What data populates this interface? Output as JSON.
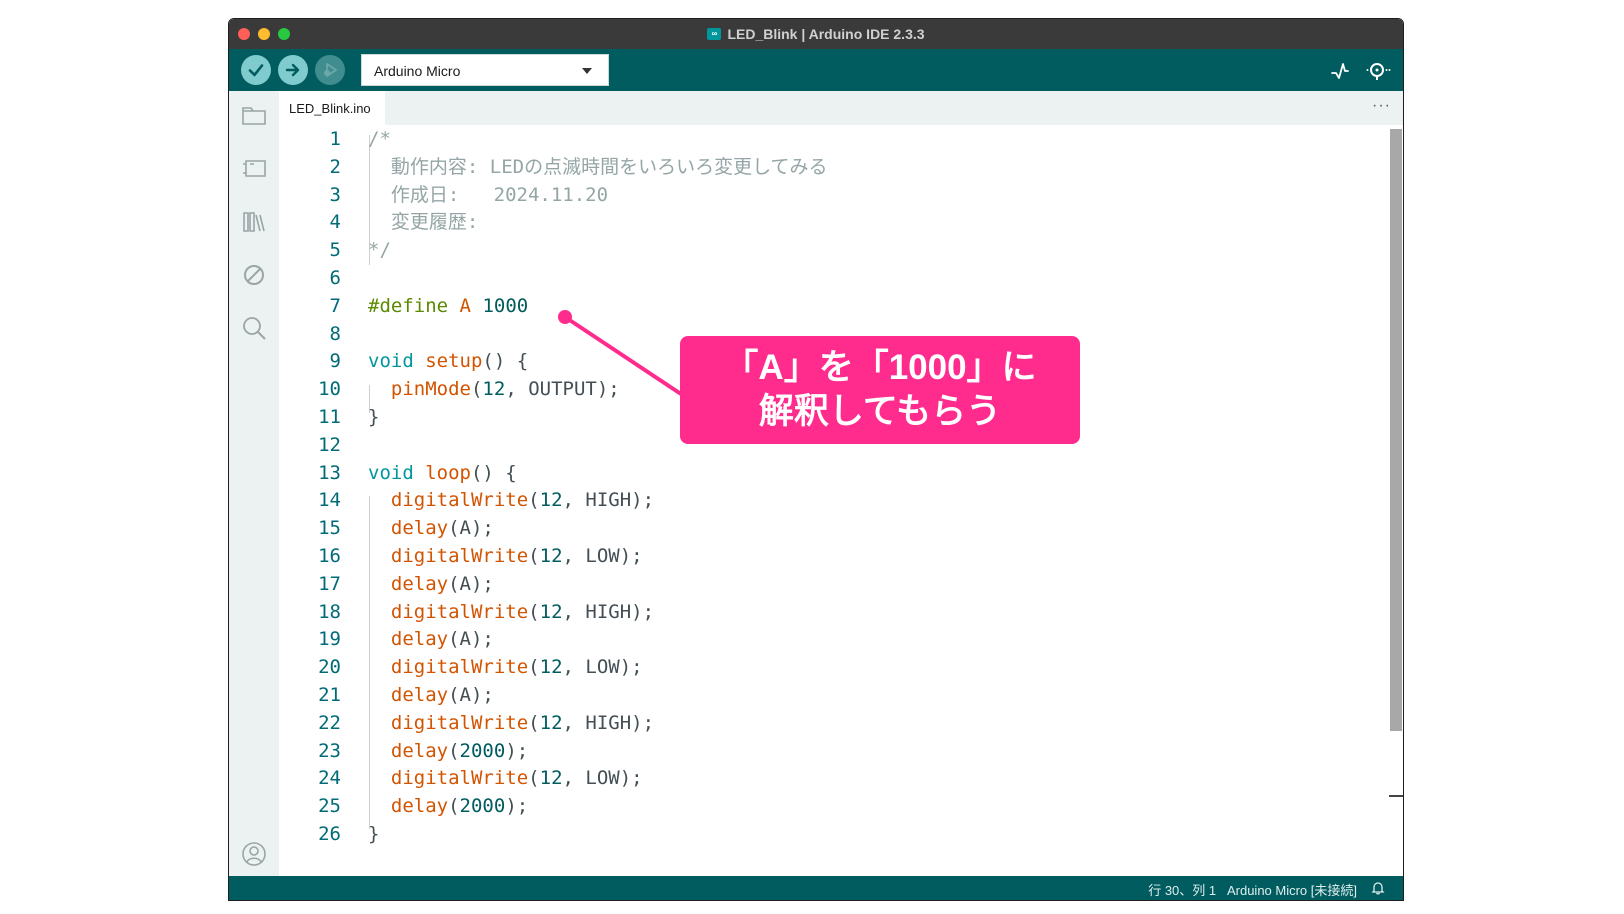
{
  "window": {
    "title": "LED_Blink | Arduino IDE 2.3.3",
    "title_icon": "arduino-logo-icon"
  },
  "toolbar": {
    "verify_icon": "check-icon",
    "upload_icon": "arrow-right-icon",
    "debug_icon": "debug-icon",
    "board_selected": "Arduino Micro",
    "serial_plotter_icon": "pulse-icon",
    "serial_monitor_icon": "magnifier-dots-icon"
  },
  "sidebar": {
    "items": [
      "folder-icon",
      "board-icon",
      "library-icon",
      "debug-off-icon",
      "search-icon"
    ],
    "bottom": "profile-icon"
  },
  "tabs": [
    {
      "label": "LED_Blink.ino",
      "active": true
    }
  ],
  "tab_more": "···",
  "editor": {
    "lines": [
      {
        "n": "1",
        "tokens": [
          [
            "c-com",
            "/*"
          ]
        ]
      },
      {
        "n": "2",
        "tokens": [
          [
            "c-com",
            "  動作内容: LEDの点滅時間をいろいろ変更してみる"
          ]
        ]
      },
      {
        "n": "3",
        "tokens": [
          [
            "c-com",
            "  作成日:   2024.11.20"
          ]
        ]
      },
      {
        "n": "4",
        "tokens": [
          [
            "c-com",
            "  変更履歴:"
          ]
        ]
      },
      {
        "n": "5",
        "tokens": [
          [
            "c-com",
            "*/"
          ]
        ]
      },
      {
        "n": "6",
        "tokens": []
      },
      {
        "n": "7",
        "tokens": [
          [
            "c-pre",
            "#define"
          ],
          [
            "c-plain",
            " "
          ],
          [
            "c-fn",
            "A"
          ],
          [
            "c-plain",
            " "
          ],
          [
            "c-num",
            "1000"
          ]
        ]
      },
      {
        "n": "8",
        "tokens": []
      },
      {
        "n": "9",
        "tokens": [
          [
            "c-kw",
            "void"
          ],
          [
            "c-plain",
            " "
          ],
          [
            "c-fn",
            "setup"
          ],
          [
            "c-plain",
            "() {"
          ]
        ]
      },
      {
        "n": "10",
        "tokens": [
          [
            "c-plain",
            "  "
          ],
          [
            "c-fn",
            "pinMode"
          ],
          [
            "c-plain",
            "("
          ],
          [
            "c-num",
            "12"
          ],
          [
            "c-plain",
            ", OUTPUT);"
          ]
        ]
      },
      {
        "n": "11",
        "tokens": [
          [
            "c-plain",
            "}"
          ]
        ]
      },
      {
        "n": "12",
        "tokens": []
      },
      {
        "n": "13",
        "tokens": [
          [
            "c-kw",
            "void"
          ],
          [
            "c-plain",
            " "
          ],
          [
            "c-fn",
            "loop"
          ],
          [
            "c-plain",
            "() {"
          ]
        ]
      },
      {
        "n": "14",
        "tokens": [
          [
            "c-plain",
            "  "
          ],
          [
            "c-fn",
            "digitalWrite"
          ],
          [
            "c-plain",
            "("
          ],
          [
            "c-num",
            "12"
          ],
          [
            "c-plain",
            ", HIGH);"
          ]
        ]
      },
      {
        "n": "15",
        "tokens": [
          [
            "c-plain",
            "  "
          ],
          [
            "c-fn",
            "delay"
          ],
          [
            "c-plain",
            "(A);"
          ]
        ]
      },
      {
        "n": "16",
        "tokens": [
          [
            "c-plain",
            "  "
          ],
          [
            "c-fn",
            "digitalWrite"
          ],
          [
            "c-plain",
            "("
          ],
          [
            "c-num",
            "12"
          ],
          [
            "c-plain",
            ", LOW);"
          ]
        ]
      },
      {
        "n": "17",
        "tokens": [
          [
            "c-plain",
            "  "
          ],
          [
            "c-fn",
            "delay"
          ],
          [
            "c-plain",
            "(A);"
          ]
        ]
      },
      {
        "n": "18",
        "tokens": [
          [
            "c-plain",
            "  "
          ],
          [
            "c-fn",
            "digitalWrite"
          ],
          [
            "c-plain",
            "("
          ],
          [
            "c-num",
            "12"
          ],
          [
            "c-plain",
            ", HIGH);"
          ]
        ]
      },
      {
        "n": "19",
        "tokens": [
          [
            "c-plain",
            "  "
          ],
          [
            "c-fn",
            "delay"
          ],
          [
            "c-plain",
            "(A);"
          ]
        ]
      },
      {
        "n": "20",
        "tokens": [
          [
            "c-plain",
            "  "
          ],
          [
            "c-fn",
            "digitalWrite"
          ],
          [
            "c-plain",
            "("
          ],
          [
            "c-num",
            "12"
          ],
          [
            "c-plain",
            ", LOW);"
          ]
        ]
      },
      {
        "n": "21",
        "tokens": [
          [
            "c-plain",
            "  "
          ],
          [
            "c-fn",
            "delay"
          ],
          [
            "c-plain",
            "(A);"
          ]
        ]
      },
      {
        "n": "22",
        "tokens": [
          [
            "c-plain",
            "  "
          ],
          [
            "c-fn",
            "digitalWrite"
          ],
          [
            "c-plain",
            "("
          ],
          [
            "c-num",
            "12"
          ],
          [
            "c-plain",
            ", HIGH);"
          ]
        ]
      },
      {
        "n": "23",
        "tokens": [
          [
            "c-plain",
            "  "
          ],
          [
            "c-fn",
            "delay"
          ],
          [
            "c-plain",
            "("
          ],
          [
            "c-num",
            "2000"
          ],
          [
            "c-plain",
            ");"
          ]
        ]
      },
      {
        "n": "24",
        "tokens": [
          [
            "c-plain",
            "  "
          ],
          [
            "c-fn",
            "digitalWrite"
          ],
          [
            "c-plain",
            "("
          ],
          [
            "c-num",
            "12"
          ],
          [
            "c-plain",
            ", LOW);"
          ]
        ]
      },
      {
        "n": "25",
        "tokens": [
          [
            "c-plain",
            "  "
          ],
          [
            "c-fn",
            "delay"
          ],
          [
            "c-plain",
            "("
          ],
          [
            "c-num",
            "2000"
          ],
          [
            "c-plain",
            ");"
          ]
        ]
      },
      {
        "n": "26",
        "tokens": [
          [
            "c-plain",
            "}"
          ]
        ]
      }
    ]
  },
  "statusbar": {
    "text": "行 30、列 1   Arduino Micro [未接続]",
    "bell_icon": "bell-icon"
  },
  "callout": {
    "line1": "「A」を「1000」に",
    "line2": "解釈してもらう",
    "color": "#ff2c8e"
  }
}
